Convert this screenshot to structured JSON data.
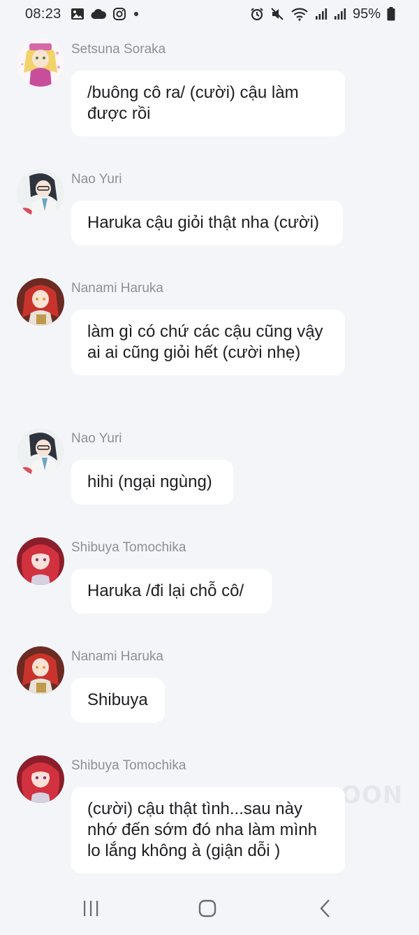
{
  "status_bar": {
    "time": "08:23",
    "left_icons": [
      "gallery-icon",
      "cloud-icon",
      "instagram-icon",
      "dot-icon"
    ],
    "right_icons": [
      "alarm-icon",
      "mute-icon",
      "wifi-icon",
      "signal-icon",
      "signal-icon"
    ],
    "battery_text": "95%"
  },
  "messages": [
    {
      "sender": "Setsuna Soraka",
      "text": "/buông cô ra/ (cười) cậu làm được rồi",
      "avatar_color": "#e8c84a"
    },
    {
      "sender": "Nao Yuri",
      "text": "Haruka cậu giỏi thật nha (cười)",
      "avatar_color": "#3b3f4a"
    },
    {
      "sender": "Nanami Haruka",
      "text": "làm gì có chứ các cậu cũng vậy ai ai cũng giỏi hết (cười nhẹ)",
      "avatar_color": "#c8342c"
    },
    {
      "sender": "Nao Yuri",
      "text": "hihi (ngại ngùng)",
      "avatar_color": "#3b3f4a"
    },
    {
      "sender": "Shibuya Tomochika",
      "text": "Haruka /đi lại chỗ cô/",
      "avatar_color": "#c02a3a"
    },
    {
      "sender": "Nanami Haruka",
      "text": "Shibuya",
      "avatar_color": "#c8342c"
    },
    {
      "sender": "Shibuya Tomochika",
      "text": "(cười) cậu thật tình...sau này nhớ đến sớm đó nha làm mình lo lắng không à (giận dỗi )",
      "avatar_color": "#c02a3a"
    }
  ],
  "watermark": "OON",
  "nav": {
    "recent_apps": "recent-apps-icon",
    "home": "home-icon",
    "back": "back-icon"
  },
  "colors": {
    "background": "#f4f5f9",
    "bubble": "#ffffff",
    "sender_text": "#8e8e93"
  }
}
